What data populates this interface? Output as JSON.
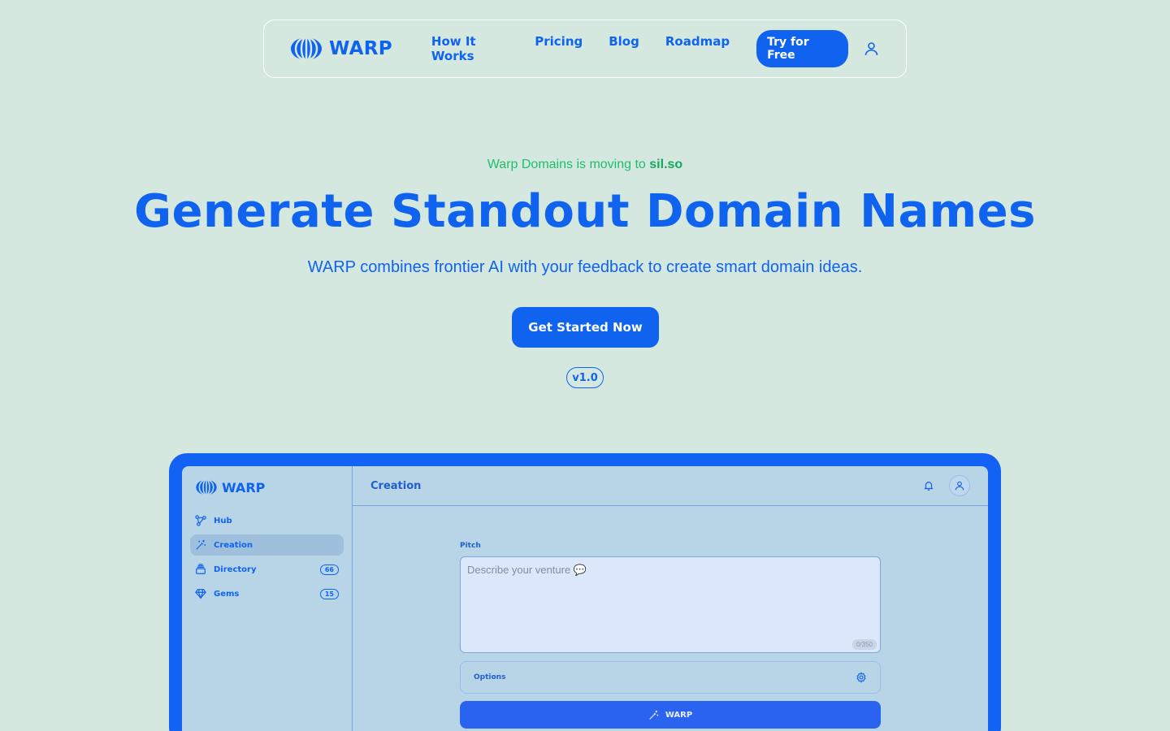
{
  "nav": {
    "logo_text": "WARP",
    "links": [
      "How It Works",
      "Pricing",
      "Blog",
      "Roadmap"
    ],
    "try_label": "Try for Free"
  },
  "hero": {
    "announce_prefix": "Warp Domains is moving to",
    "announce_domain": "sil.so",
    "title": "Generate Standout Domain Names",
    "subtitle": "WARP combines frontier AI with your feedback to create smart domain ideas.",
    "cta_label": "Get Started Now",
    "version": "v1.0"
  },
  "preview": {
    "logo_text": "WARP",
    "sidebar": [
      {
        "label": "Hub",
        "icon": "hub-icon",
        "count": null,
        "active": false
      },
      {
        "label": "Creation",
        "icon": "magic-wand-icon",
        "count": null,
        "active": true
      },
      {
        "label": "Directory",
        "icon": "stack-icon",
        "count": "66",
        "active": false
      },
      {
        "label": "Gems",
        "icon": "gem-icon",
        "count": "15",
        "active": false
      }
    ],
    "header_title": "Creation",
    "pitch_label": "Pitch",
    "pitch_placeholder": "Describe your venture 💬",
    "pitch_counter": "0/350",
    "options_label": "Options",
    "warp_button_label": "WARP"
  },
  "colors": {
    "background": "#d4e8e0",
    "brand_blue": "#0f63ee",
    "announce_green": "#1fbe6a"
  }
}
